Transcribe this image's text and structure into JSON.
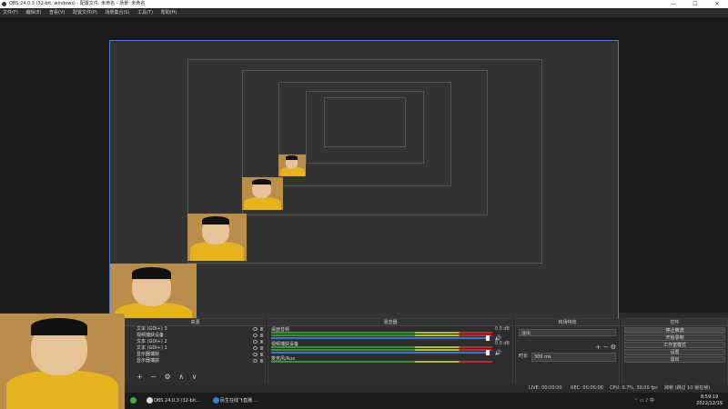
{
  "window": {
    "title": "OBS 24.0.3 (32-bit, windows) - 配置文件: 未命名 - 场景: 未命名",
    "min": "—",
    "max": "☐",
    "close": "✕"
  },
  "menu": [
    "文件(F)",
    "编辑(E)",
    "查看(V)",
    "配置文件(P)",
    "场景集合(S)",
    "工具(T)",
    "帮助(H)"
  ],
  "sources": {
    "title": "来源",
    "items": [
      "文本 (GDI+) 3",
      "视频捕获设备",
      "文本 (GDI+) 2",
      "文本 (GDI+) 1",
      "显示器捕获",
      "显示器捕获"
    ],
    "tools": "+ − ⚙ ∧ ∨"
  },
  "mixer": {
    "title": "混音器",
    "tracks": [
      {
        "name": "桌面音频",
        "db": "0.0 dB"
      },
      {
        "name": "视频捕获设备",
        "db": "0.0 dB"
      },
      {
        "name": "麦克风/Aux",
        "db": ""
      }
    ]
  },
  "transitions": {
    "title": "转场特效",
    "type": "淡出",
    "duration_label": "时长",
    "duration": "300 ms"
  },
  "controls": {
    "title": "控件",
    "buttons": [
      "停止推流",
      "开始录制",
      "工作室模式",
      "设置",
      "退出"
    ]
  },
  "status": {
    "live": "LIVE: 00:00:00",
    "rec": "REC: 00:00:00",
    "cpu": "CPU: 0.7%, 30.00 fps",
    "dropped": "掉帧 (跳过 10 帧在帧)"
  },
  "taskbar": {
    "items": [
      "OBS 24.0.3 (32-bit...",
      "民生在线飞直播 ..."
    ],
    "time": "8:59:19",
    "date": "2022/12/19"
  }
}
